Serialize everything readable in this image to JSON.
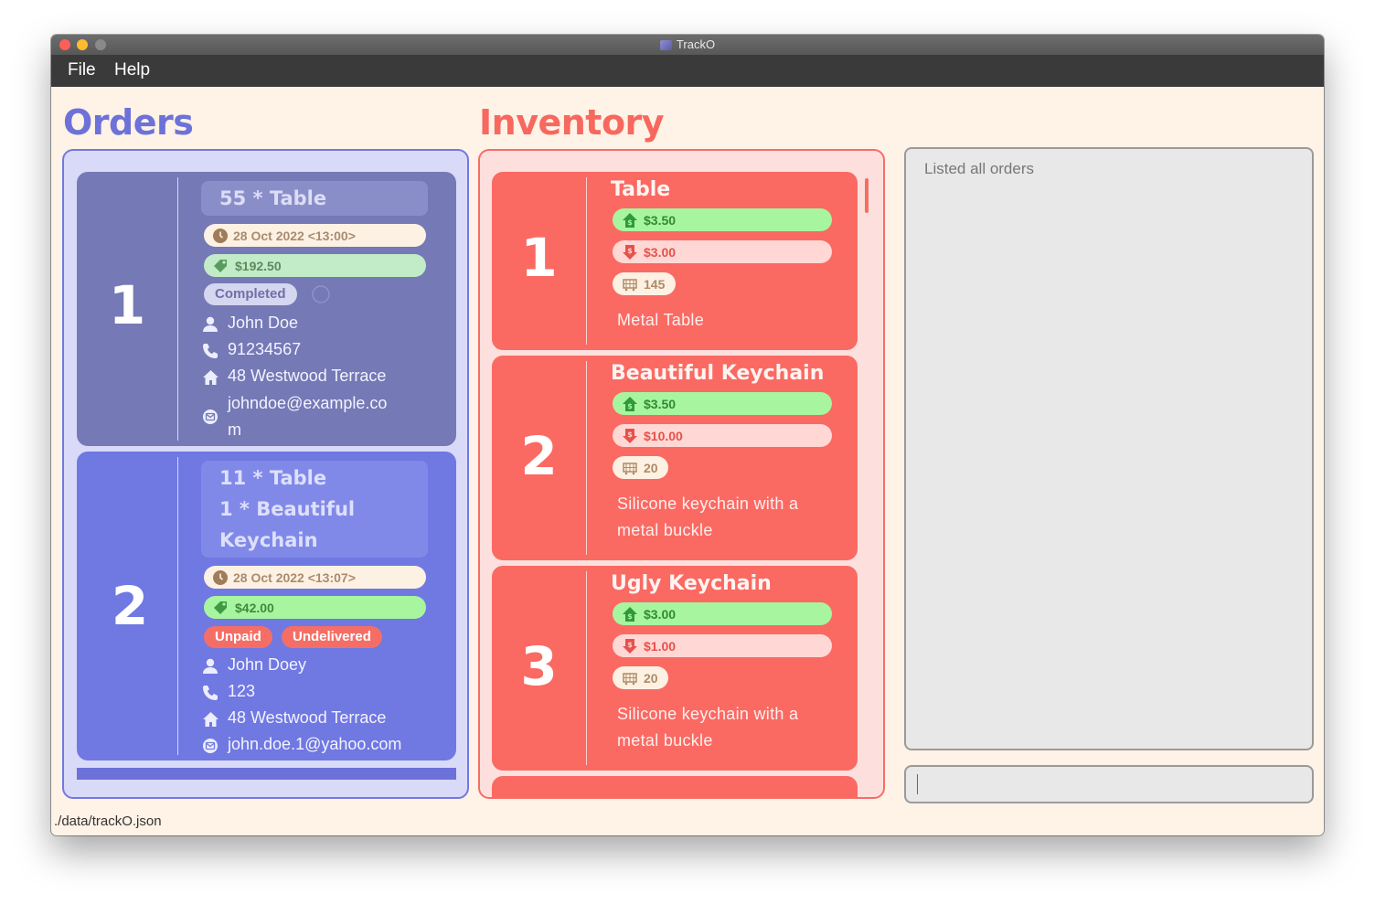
{
  "window": {
    "title": "TrackO"
  },
  "menu": {
    "file": "File",
    "help": "Help"
  },
  "orders_title": "Orders",
  "inventory_title": "Inventory",
  "orders": [
    {
      "index": "1",
      "items": [
        "55 * Table"
      ],
      "date": "28 Oct 2022 <13:00>",
      "total": "$192.50",
      "status": [
        "Completed"
      ],
      "name": "John Doe",
      "phone": "91234567",
      "address": "48 Westwood Terrace",
      "email": "johndoe@example.co​m"
    },
    {
      "index": "2",
      "items": [
        "11 * Table",
        "1 * Beautiful",
        "Keychain"
      ],
      "date": "28 Oct 2022 <13:07>",
      "total": "$42.00",
      "status": [
        "Unpaid",
        "Undelivered"
      ],
      "name": "John Doey",
      "phone": "123",
      "address": "48 Westwood Terrace",
      "email": "john.doe.1@yahoo.com"
    }
  ],
  "inventory": [
    {
      "index": "1",
      "name": "Table",
      "sell_price": "$3.50",
      "cost_price": "$3.00",
      "quantity": "145",
      "description": "Metal Table"
    },
    {
      "index": "2",
      "name": "Beautiful Keychain",
      "sell_price": "$3.50",
      "cost_price": "$10.00",
      "quantity": "20",
      "description": "Silicone keychain with a metal buckle"
    },
    {
      "index": "3",
      "name": "Ugly Keychain",
      "sell_price": "$3.00",
      "cost_price": "$1.00",
      "quantity": "20",
      "description": "Silicone keychain with a metal buckle"
    }
  ],
  "result_text": "Listed all orders",
  "command_input": "",
  "status_bar": "./data/trackO.json",
  "colors": {
    "orders_accent": "#6c72d8",
    "inventory_accent": "#f7685f",
    "completed_order_card": "#7579b5",
    "pending_order_card": "#7078e2",
    "paid_green": "#a8f59f",
    "status_red": "#f56e66"
  }
}
